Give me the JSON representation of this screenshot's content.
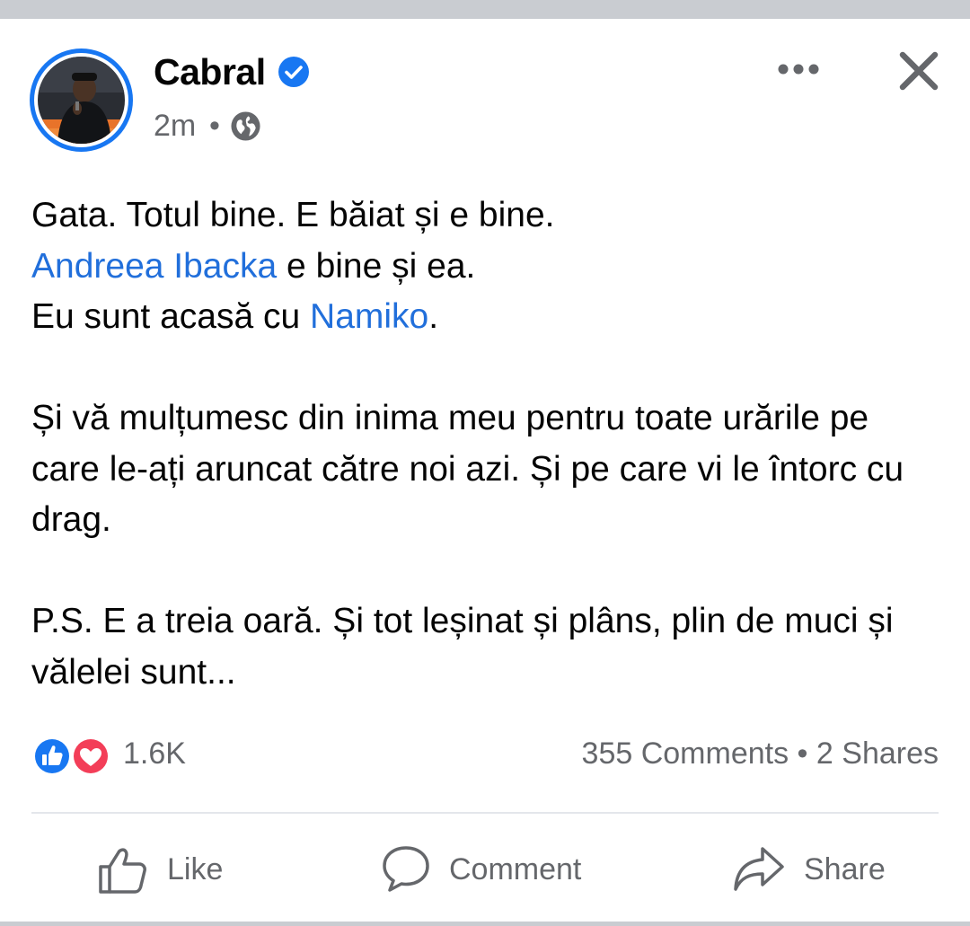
{
  "post": {
    "author": "Cabral",
    "time": "2m",
    "separator": "•",
    "text": {
      "line1": "Gata. Totul bine. E băiat și e bine.",
      "line2_mention": "Andreea Ibacka",
      "line2_rest": " e bine și ea.",
      "line3_start": "Eu sunt acasă cu ",
      "line3_mention": "Namiko",
      "line3_end": ".",
      "para2": "Și vă mulțumesc din inima meu pentru toate urările pe care le-ați aruncat către noi azi. Și pe care vi le întorc cu drag.",
      "para3": "P.S. E a treia oară. Și tot leșinat și plâns, plin de muci și vălelei sunt..."
    }
  },
  "stats": {
    "reactions_count": "1.6K",
    "comments": "355 Comments",
    "separator": "•",
    "shares": "2 Shares"
  },
  "actions": {
    "like_label": "Like",
    "comment_label": "Comment",
    "share_label": "Share"
  },
  "icons": [
    "verified-icon",
    "globe-icon",
    "more-icon",
    "close-icon",
    "like-reaction-icon",
    "love-reaction-icon",
    "thumbs-up-icon",
    "comment-icon",
    "share-icon"
  ],
  "colors": {
    "accent": "#1877f2",
    "mention": "#216fdb",
    "secondary_text": "#65676b",
    "love": "#f33e58"
  }
}
